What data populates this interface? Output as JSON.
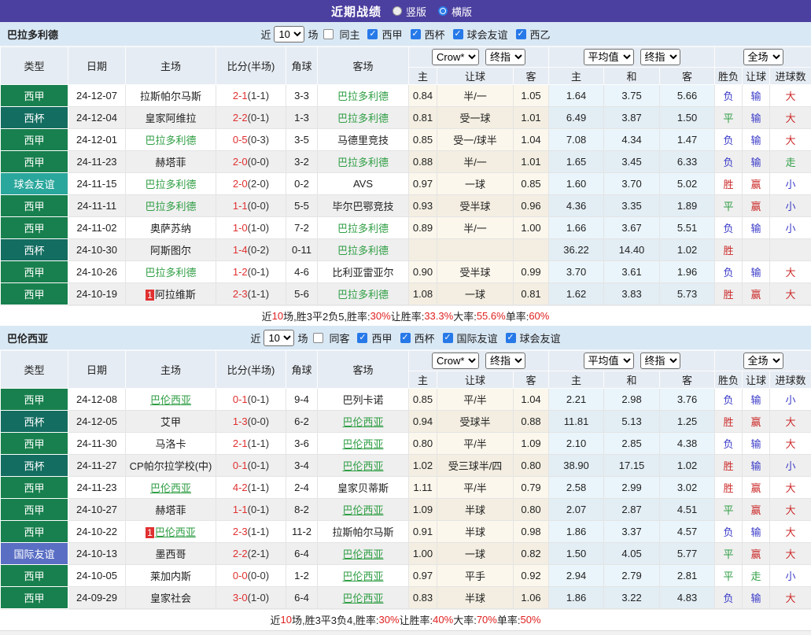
{
  "title_bar": {
    "title": "近期战绩",
    "vertical_label": "竖版",
    "horizontal_label": "横版",
    "selected": "横版"
  },
  "league_colors": {
    "西甲": "#18804e",
    "西杯": "#136d60",
    "球会友谊": "#2aa79c",
    "国际友谊": "#5a6fc4"
  },
  "colors": {
    "titlebar_purple": "#4b3f9f",
    "section_strip_blue": "#d9e8f5",
    "table_header_bg": "#e6ecf3",
    "tracked_team_green": "#2f9e44",
    "score_red": "#e03030",
    "win_red": "#cc2b2b",
    "loss_blue": "#3a3ac9",
    "draw_green": "#2f9e44",
    "handicap_cols_bg": "#fcf7ec",
    "average_cols_bg": "#eaf5fb",
    "row_stripe": "#efefef",
    "summary_value_red": "#e02020"
  },
  "sections": [
    {
      "team": "巴拉多利德",
      "filter": {
        "near_label": "近",
        "games": "10",
        "games_label": "场",
        "same_label": "同主",
        "same_checked": false,
        "leagues": [
          {
            "label": "西甲",
            "checked": true
          },
          {
            "label": "西杯",
            "checked": true
          },
          {
            "label": "球会友谊",
            "checked": true
          },
          {
            "label": "西乙",
            "checked": true
          }
        ]
      },
      "header": {
        "cols": [
          "类型",
          "日期",
          "主场",
          "比分(半场)",
          "角球",
          "客场"
        ],
        "odds_select": "Crow*",
        "odds_final_select": "终指",
        "avg_select": "平均值",
        "avg_final_select": "终指",
        "full_select": "全场",
        "sub": [
          "主",
          "让球",
          "客",
          "主",
          "和",
          "客",
          "胜负",
          "让球",
          "进球数"
        ]
      },
      "rows": [
        {
          "type": "西甲",
          "date": "24-12-07",
          "home": "拉斯帕尔马斯",
          "home_tracked": false,
          "home_badge": "",
          "away": "巴拉多利德",
          "away_tracked": true,
          "away_badge": "",
          "score": "2-1",
          "half": "1-1",
          "corner": "3-3",
          "o_home": "0.84",
          "handicap": "半/一",
          "o_away": "1.05",
          "a_home": "1.64",
          "a_draw": "3.75",
          "a_away": "5.66",
          "res": "负",
          "hres": "输",
          "gres": "大"
        },
        {
          "type": "西杯",
          "date": "24-12-04",
          "home": "皇家阿维拉",
          "home_tracked": false,
          "home_badge": "",
          "away": "巴拉多利德",
          "away_tracked": true,
          "away_badge": "",
          "score": "2-2",
          "half": "0-1",
          "corner": "1-3",
          "o_home": "0.81",
          "handicap": "受一球",
          "o_away": "1.01",
          "a_home": "6.49",
          "a_draw": "3.87",
          "a_away": "1.50",
          "res": "平",
          "hres": "输",
          "gres": "大"
        },
        {
          "type": "西甲",
          "date": "24-12-01",
          "home": "巴拉多利德",
          "home_tracked": true,
          "home_badge": "",
          "away": "马德里竞技",
          "away_tracked": false,
          "away_badge": "",
          "score": "0-5",
          "half": "0-3",
          "corner": "3-5",
          "o_home": "0.85",
          "handicap": "受一/球半",
          "o_away": "1.04",
          "a_home": "7.08",
          "a_draw": "4.34",
          "a_away": "1.47",
          "res": "负",
          "hres": "输",
          "gres": "大"
        },
        {
          "type": "西甲",
          "date": "24-11-23",
          "home": "赫塔菲",
          "home_tracked": false,
          "home_badge": "",
          "away": "巴拉多利德",
          "away_tracked": true,
          "away_badge": "",
          "score": "2-0",
          "half": "0-0",
          "corner": "3-2",
          "o_home": "0.88",
          "handicap": "半/一",
          "o_away": "1.01",
          "a_home": "1.65",
          "a_draw": "3.45",
          "a_away": "6.33",
          "res": "负",
          "hres": "输",
          "gres": "走"
        },
        {
          "type": "球会友谊",
          "date": "24-11-15",
          "home": "巴拉多利德",
          "home_tracked": true,
          "home_badge": "",
          "away": "AVS",
          "away_tracked": false,
          "away_badge": "",
          "score": "2-0",
          "half": "2-0",
          "corner": "0-2",
          "o_home": "0.97",
          "handicap": "一球",
          "o_away": "0.85",
          "a_home": "1.60",
          "a_draw": "3.70",
          "a_away": "5.02",
          "res": "胜",
          "hres": "赢",
          "gres": "小"
        },
        {
          "type": "西甲",
          "date": "24-11-11",
          "home": "巴拉多利德",
          "home_tracked": true,
          "home_badge": "",
          "away": "毕尔巴鄂竞技",
          "away_tracked": false,
          "away_badge": "",
          "score": "1-1",
          "half": "0-0",
          "corner": "5-5",
          "o_home": "0.93",
          "handicap": "受半球",
          "o_away": "0.96",
          "a_home": "4.36",
          "a_draw": "3.35",
          "a_away": "1.89",
          "res": "平",
          "hres": "赢",
          "gres": "小"
        },
        {
          "type": "西甲",
          "date": "24-11-02",
          "home": "奥萨苏纳",
          "home_tracked": false,
          "home_badge": "",
          "away": "巴拉多利德",
          "away_tracked": true,
          "away_badge": "",
          "score": "1-0",
          "half": "1-0",
          "corner": "7-2",
          "o_home": "0.89",
          "handicap": "半/一",
          "o_away": "1.00",
          "a_home": "1.66",
          "a_draw": "3.67",
          "a_away": "5.51",
          "res": "负",
          "hres": "输",
          "gres": "小"
        },
        {
          "type": "西杯",
          "date": "24-10-30",
          "home": "阿斯图尔",
          "home_tracked": false,
          "home_badge": "",
          "away": "巴拉多利德",
          "away_tracked": true,
          "away_badge": "",
          "score": "1-4",
          "half": "0-2",
          "corner": "0-11",
          "o_home": "",
          "handicap": "",
          "o_away": "",
          "a_home": "36.22",
          "a_draw": "14.40",
          "a_away": "1.02",
          "res": "胜",
          "hres": "",
          "gres": ""
        },
        {
          "type": "西甲",
          "date": "24-10-26",
          "home": "巴拉多利德",
          "home_tracked": true,
          "home_badge": "",
          "away": "比利亚雷亚尔",
          "away_tracked": false,
          "away_badge": "",
          "score": "1-2",
          "half": "0-1",
          "corner": "4-6",
          "o_home": "0.90",
          "handicap": "受半球",
          "o_away": "0.99",
          "a_home": "3.70",
          "a_draw": "3.61",
          "a_away": "1.96",
          "res": "负",
          "hres": "输",
          "gres": "大"
        },
        {
          "type": "西甲",
          "date": "24-10-19",
          "home": "阿拉维斯",
          "home_tracked": false,
          "home_badge": "1",
          "away": "巴拉多利德",
          "away_tracked": true,
          "away_badge": "",
          "score": "2-3",
          "half": "1-1",
          "corner": "5-6",
          "o_home": "1.08",
          "handicap": "一球",
          "o_away": "0.81",
          "a_home": "1.62",
          "a_draw": "3.83",
          "a_away": "5.73",
          "res": "胜",
          "hres": "赢",
          "gres": "大"
        }
      ],
      "summary": [
        {
          "text": "近",
          "highlight": false
        },
        {
          "text": "10",
          "highlight": true
        },
        {
          "text": "场,胜3平2负5, ",
          "highlight": false
        },
        {
          "text": "胜率:",
          "highlight": false
        },
        {
          "text": "30%",
          "highlight": true
        },
        {
          "text": " 让胜率:",
          "highlight": false
        },
        {
          "text": "33.3%",
          "highlight": true
        },
        {
          "text": " 大率:",
          "highlight": false
        },
        {
          "text": "55.6%",
          "highlight": true
        },
        {
          "text": " 单率:",
          "highlight": false
        },
        {
          "text": "60%",
          "highlight": true
        }
      ]
    },
    {
      "team": "巴伦西亚",
      "filter": {
        "near_label": "近",
        "games": "10",
        "games_label": "场",
        "same_label": "同客",
        "same_checked": false,
        "leagues": [
          {
            "label": "西甲",
            "checked": true
          },
          {
            "label": "西杯",
            "checked": true
          },
          {
            "label": "国际友谊",
            "checked": true
          },
          {
            "label": "球会友谊",
            "checked": true
          }
        ]
      },
      "header": {
        "cols": [
          "类型",
          "日期",
          "主场",
          "比分(半场)",
          "角球",
          "客场"
        ],
        "odds_select": "Crow*",
        "odds_final_select": "终指",
        "avg_select": "平均值",
        "avg_final_select": "终指",
        "full_select": "全场",
        "sub": [
          "主",
          "让球",
          "客",
          "主",
          "和",
          "客",
          "胜负",
          "让球",
          "进球数"
        ]
      },
      "rows": [
        {
          "type": "西甲",
          "date": "24-12-08",
          "home": "巴伦西亚",
          "home_tracked": true,
          "home_badge": "",
          "away": "巴列卡诺",
          "away_tracked": false,
          "away_badge": "",
          "score": "0-1",
          "half": "0-1",
          "corner": "9-4",
          "o_home": "0.85",
          "handicap": "平/半",
          "o_away": "1.04",
          "a_home": "2.21",
          "a_draw": "2.98",
          "a_away": "3.76",
          "res": "负",
          "hres": "输",
          "gres": "小"
        },
        {
          "type": "西杯",
          "date": "24-12-05",
          "home": "艾甲",
          "home_tracked": false,
          "home_badge": "",
          "away": "巴伦西亚",
          "away_tracked": true,
          "away_badge": "",
          "score": "1-3",
          "half": "0-0",
          "corner": "6-2",
          "o_home": "0.94",
          "handicap": "受球半",
          "o_away": "0.88",
          "a_home": "11.81",
          "a_draw": "5.13",
          "a_away": "1.25",
          "res": "胜",
          "hres": "赢",
          "gres": "大"
        },
        {
          "type": "西甲",
          "date": "24-11-30",
          "home": "马洛卡",
          "home_tracked": false,
          "home_badge": "",
          "away": "巴伦西亚",
          "away_tracked": true,
          "away_badge": "",
          "score": "2-1",
          "half": "1-1",
          "corner": "3-6",
          "o_home": "0.80",
          "handicap": "平/半",
          "o_away": "1.09",
          "a_home": "2.10",
          "a_draw": "2.85",
          "a_away": "4.38",
          "res": "负",
          "hres": "输",
          "gres": "大"
        },
        {
          "type": "西杯",
          "date": "24-11-27",
          "home": "CP帕尔拉学校(中)",
          "home_tracked": false,
          "home_badge": "",
          "away": "巴伦西亚",
          "away_tracked": true,
          "away_badge": "",
          "score": "0-1",
          "half": "0-1",
          "corner": "3-4",
          "o_home": "1.02",
          "handicap": "受三球半/四",
          "o_away": "0.80",
          "a_home": "38.90",
          "a_draw": "17.15",
          "a_away": "1.02",
          "res": "胜",
          "hres": "输",
          "gres": "小"
        },
        {
          "type": "西甲",
          "date": "24-11-23",
          "home": "巴伦西亚",
          "home_tracked": true,
          "home_badge": "",
          "away": "皇家贝蒂斯",
          "away_tracked": false,
          "away_badge": "",
          "score": "4-2",
          "half": "1-1",
          "corner": "2-4",
          "o_home": "1.11",
          "handicap": "平/半",
          "o_away": "0.79",
          "a_home": "2.58",
          "a_draw": "2.99",
          "a_away": "3.02",
          "res": "胜",
          "hres": "赢",
          "gres": "大"
        },
        {
          "type": "西甲",
          "date": "24-10-27",
          "home": "赫塔菲",
          "home_tracked": false,
          "home_badge": "",
          "away": "巴伦西亚",
          "away_tracked": true,
          "away_badge": "",
          "score": "1-1",
          "half": "0-1",
          "corner": "8-2",
          "o_home": "1.09",
          "handicap": "半球",
          "o_away": "0.80",
          "a_home": "2.07",
          "a_draw": "2.87",
          "a_away": "4.51",
          "res": "平",
          "hres": "赢",
          "gres": "大"
        },
        {
          "type": "西甲",
          "date": "24-10-22",
          "home": "巴伦西亚",
          "home_tracked": true,
          "home_badge": "1",
          "away": "拉斯帕尔马斯",
          "away_tracked": false,
          "away_badge": "",
          "score": "2-3",
          "half": "1-1",
          "corner": "11-2",
          "o_home": "0.91",
          "handicap": "半球",
          "o_away": "0.98",
          "a_home": "1.86",
          "a_draw": "3.37",
          "a_away": "4.57",
          "res": "负",
          "hres": "输",
          "gres": "大"
        },
        {
          "type": "国际友谊",
          "date": "24-10-13",
          "home": "墨西哥",
          "home_tracked": false,
          "home_badge": "",
          "away": "巴伦西亚",
          "away_tracked": true,
          "away_badge": "",
          "score": "2-2",
          "half": "2-1",
          "corner": "6-4",
          "o_home": "1.00",
          "handicap": "一球",
          "o_away": "0.82",
          "a_home": "1.50",
          "a_draw": "4.05",
          "a_away": "5.77",
          "res": "平",
          "hres": "赢",
          "gres": "大"
        },
        {
          "type": "西甲",
          "date": "24-10-05",
          "home": "莱加内斯",
          "home_tracked": false,
          "home_badge": "",
          "away": "巴伦西亚",
          "away_tracked": true,
          "away_badge": "",
          "score": "0-0",
          "half": "0-0",
          "corner": "1-2",
          "o_home": "0.97",
          "handicap": "平手",
          "o_away": "0.92",
          "a_home": "2.94",
          "a_draw": "2.79",
          "a_away": "2.81",
          "res": "平",
          "hres": "走",
          "gres": "小"
        },
        {
          "type": "西甲",
          "date": "24-09-29",
          "home": "皇家社会",
          "home_tracked": false,
          "home_badge": "",
          "away": "巴伦西亚",
          "away_tracked": true,
          "away_badge": "",
          "score": "3-0",
          "half": "1-0",
          "corner": "6-4",
          "o_home": "0.83",
          "handicap": "半球",
          "o_away": "1.06",
          "a_home": "1.86",
          "a_draw": "3.22",
          "a_away": "4.83",
          "res": "负",
          "hres": "输",
          "gres": "大"
        }
      ],
      "summary": [
        {
          "text": "近",
          "highlight": false
        },
        {
          "text": "10",
          "highlight": true
        },
        {
          "text": "场,胜3平3负4, ",
          "highlight": false
        },
        {
          "text": "胜率:",
          "highlight": false
        },
        {
          "text": "30%",
          "highlight": true
        },
        {
          "text": " 让胜率:",
          "highlight": false
        },
        {
          "text": "40%",
          "highlight": true
        },
        {
          "text": " 大率:",
          "highlight": false
        },
        {
          "text": "70%",
          "highlight": true
        },
        {
          "text": " 单率:",
          "highlight": false
        },
        {
          "text": "50%",
          "highlight": true
        }
      ]
    }
  ]
}
